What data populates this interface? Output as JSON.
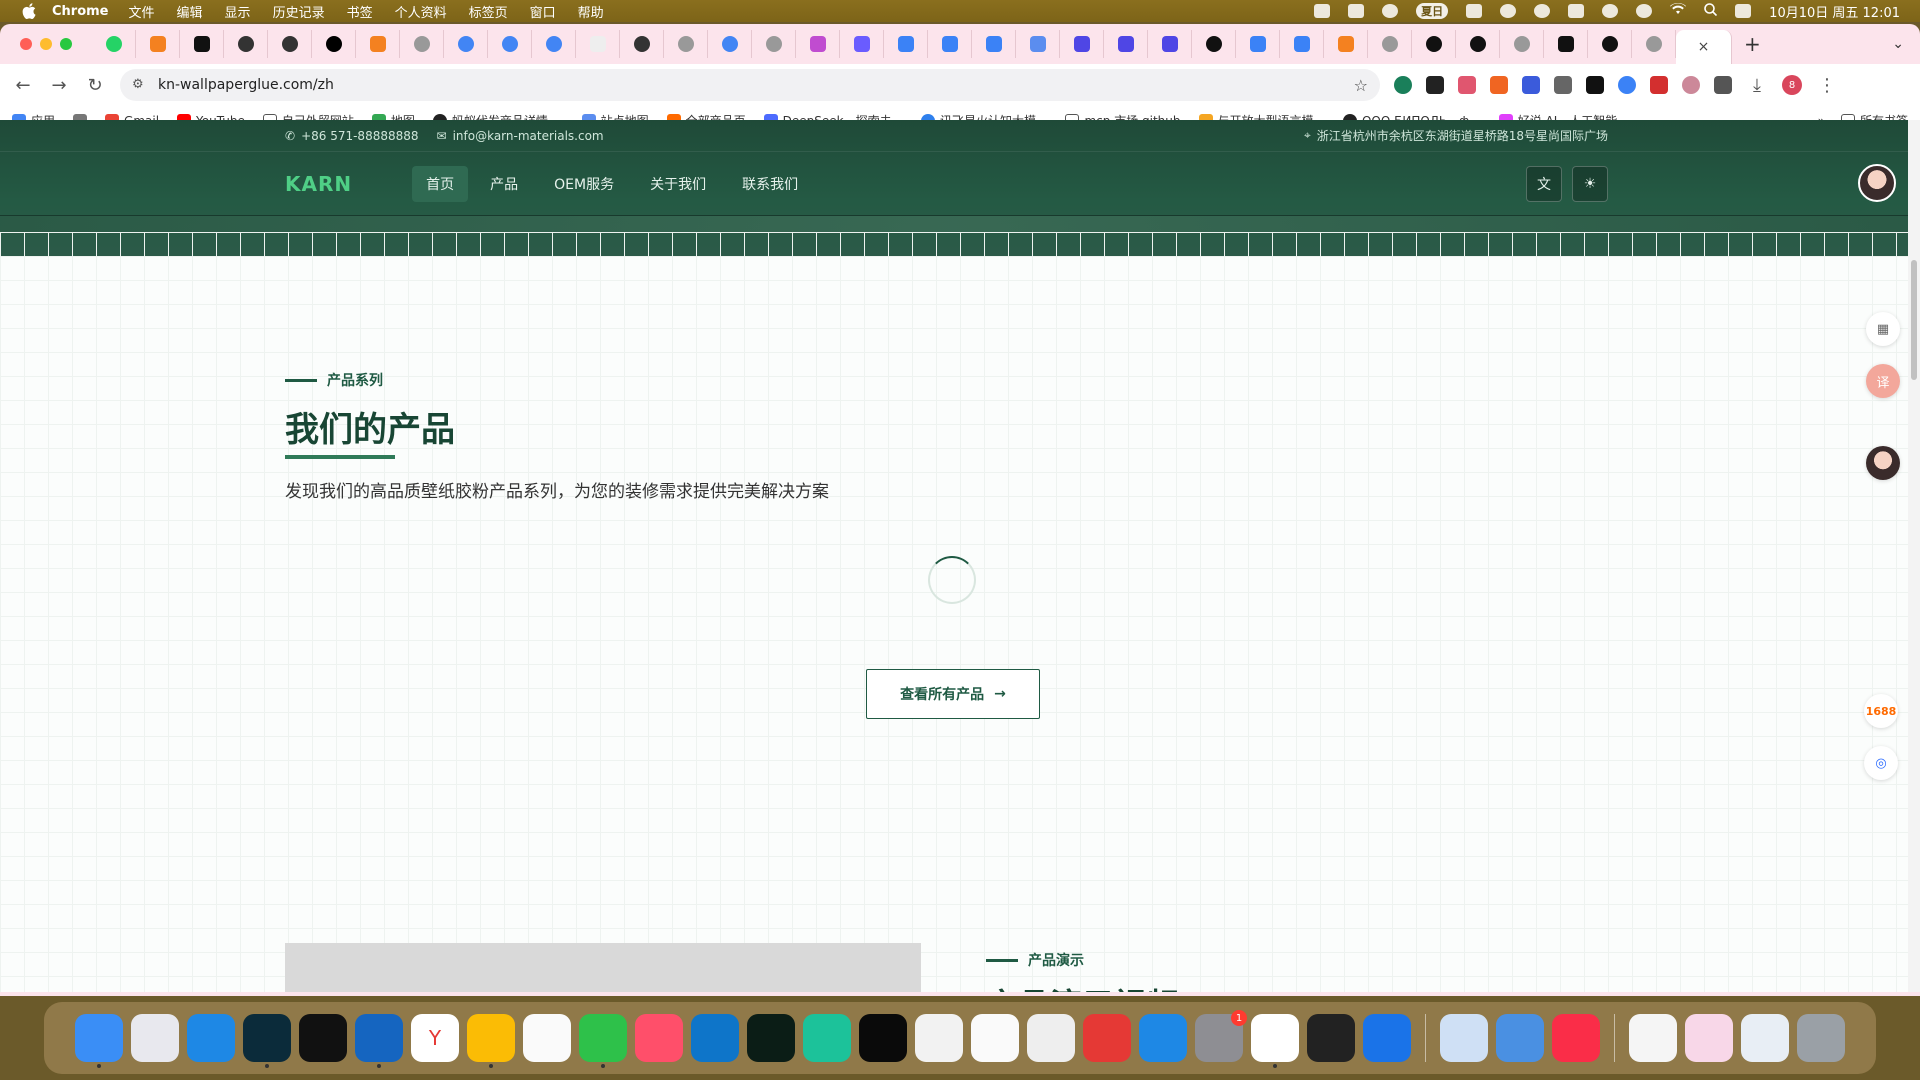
{
  "menubar": {
    "app_name": "Chrome",
    "items": [
      "文件",
      "编辑",
      "显示",
      "历史记录",
      "书签",
      "个人资料",
      "标签页",
      "窗口",
      "帮助"
    ],
    "badge": "夏日",
    "clock": "10月10日 周五 12:01"
  },
  "browser": {
    "url": "kn-wallpaperglue.com/zh",
    "new_tab": "+",
    "tab_close": "×",
    "profile_initial": "8"
  },
  "bookmarks": {
    "items": [
      "应用",
      "Gmail",
      "YouTube",
      "自己外贸网站",
      "地图",
      "蚂蚁代发商品详情-...",
      "站点地图",
      "全部商品页",
      "DeepSeek - 探索未...",
      "讯飞星火认知大模...",
      "mcp 市场 github",
      "与开放大型语言模...",
      "ООО БИПОЛЬ - ф...",
      "好说 AI - 人工智能..."
    ],
    "all_bookmarks": "所有书签"
  },
  "site": {
    "phone": "+86 571-88888888",
    "email": "info@karn-materials.com",
    "address": "浙江省杭州市余杭区东湖街道星桥路18号星尚国际广场",
    "logo": "KARN",
    "nav": [
      "首页",
      "产品",
      "OEM服务",
      "关于我们",
      "联系我们"
    ],
    "products": {
      "eyebrow": "产品系列",
      "title": "我们的产品",
      "description": "发现我们的高品质壁纸胶粉产品系列，为您的装修需求提供完美解决方案",
      "cta": "查看所有产品"
    },
    "demo": {
      "eyebrow": "产品演示",
      "title": "产品演示视频"
    },
    "side_widgets": {
      "ali_label": "1688"
    }
  },
  "colors": {
    "brand_green": "#1f5a43",
    "logo_green": "#4fcf86",
    "header_bg": "#1f4a38"
  }
}
